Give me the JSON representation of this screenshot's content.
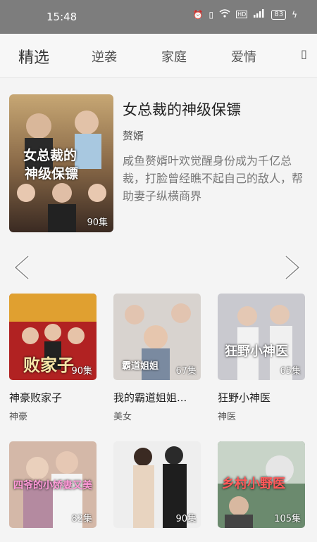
{
  "status": {
    "time": "15:48",
    "battery": "83"
  },
  "tabs": [
    "精选",
    "逆袭",
    "家庭",
    "爱情"
  ],
  "featured": {
    "title": "女总裁的神级保镖",
    "author": "赘婿",
    "description": "咸鱼赘婿叶欢觉醒身份成为千亿总裁，打脸曾经瞧不起自己的敌人，帮助妻子纵横商界",
    "episodes": "90集",
    "cover_text": [
      "女总裁的",
      "神级保镖"
    ]
  },
  "cards": [
    {
      "name": "神豪败家子",
      "tag": "神豪",
      "episodes": "90集",
      "cover_text": "败家子"
    },
    {
      "name": "我的霸道姐姐...",
      "tag": "美女",
      "episodes": "67集",
      "cover_text": "霸道姐姐"
    },
    {
      "name": "狂野小神医",
      "tag": "神医",
      "episodes": "65集",
      "cover_text": "狂野小神医"
    },
    {
      "name": "",
      "tag": "",
      "episodes": "82集",
      "cover_text": "四爷的小娇妻又美"
    },
    {
      "name": "",
      "tag": "",
      "episodes": "90集",
      "cover_text": ""
    },
    {
      "name": "",
      "tag": "",
      "episodes": "105集",
      "cover_text": "乡村小野医"
    }
  ],
  "icons": [
    "alarm-icon",
    "vibrate-icon",
    "wifi-icon",
    "hd-icon",
    "signal-icon",
    "battery-icon",
    "charging-icon",
    "chevron-left-icon",
    "chevron-right-icon"
  ]
}
